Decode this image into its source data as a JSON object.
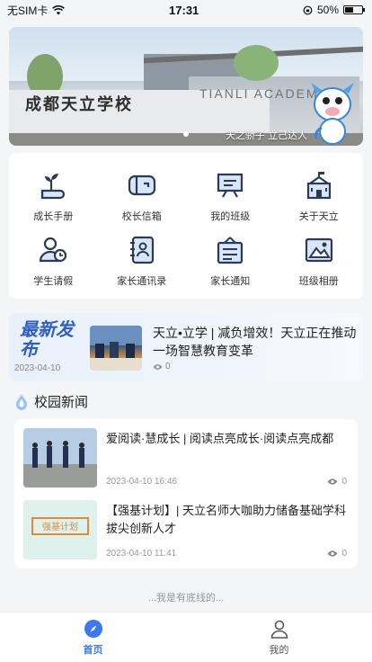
{
  "status": {
    "carrier": "无SIM卡",
    "time": "17:31",
    "battery": "50%",
    "battery_level": 0.5
  },
  "banner": {
    "school_name": "成都天立学校",
    "academy": "TIANLI ACADEMY",
    "slogan": "天之骄子 立己达人"
  },
  "menu": [
    {
      "label": "成长手册",
      "icon": "growth-handbook-icon"
    },
    {
      "label": "校长信箱",
      "icon": "mailbox-icon"
    },
    {
      "label": "我的班级",
      "icon": "class-board-icon"
    },
    {
      "label": "关于天立",
      "icon": "school-building-icon"
    },
    {
      "label": "学生请假",
      "icon": "student-leave-icon"
    },
    {
      "label": "家长通讯录",
      "icon": "address-book-icon"
    },
    {
      "label": "家长通知",
      "icon": "notice-board-icon"
    },
    {
      "label": "班级相册",
      "icon": "photo-album-icon"
    }
  ],
  "latest": {
    "title": "最新发布",
    "date": "2023-04-10",
    "headline": "天立•立学 | 减负增效！天立正在推动一场智慧教育变革",
    "views": "0"
  },
  "news_section": {
    "title": "校园新闻"
  },
  "news": [
    {
      "title": "爱阅读·慧成长 | 阅读点亮成长·阅读点亮成都",
      "time": "2023-04-10 16:46",
      "views": "0"
    },
    {
      "title": "【强基计划】| 天立名师大咖助力储备基础学科拔尖创新人才",
      "time": "2023-04-10 11:41",
      "views": "0",
      "thumb_text": "强基计划"
    }
  ],
  "footer_text": "...我是有底线的...",
  "tabs": [
    {
      "label": "首页",
      "icon": "compass-icon",
      "active": true
    },
    {
      "label": "我的",
      "icon": "person-icon",
      "active": false
    }
  ],
  "colors": {
    "accent": "#3b78f1",
    "icon_dark": "#2b3a55",
    "latest_title": "#2f5fbf"
  }
}
